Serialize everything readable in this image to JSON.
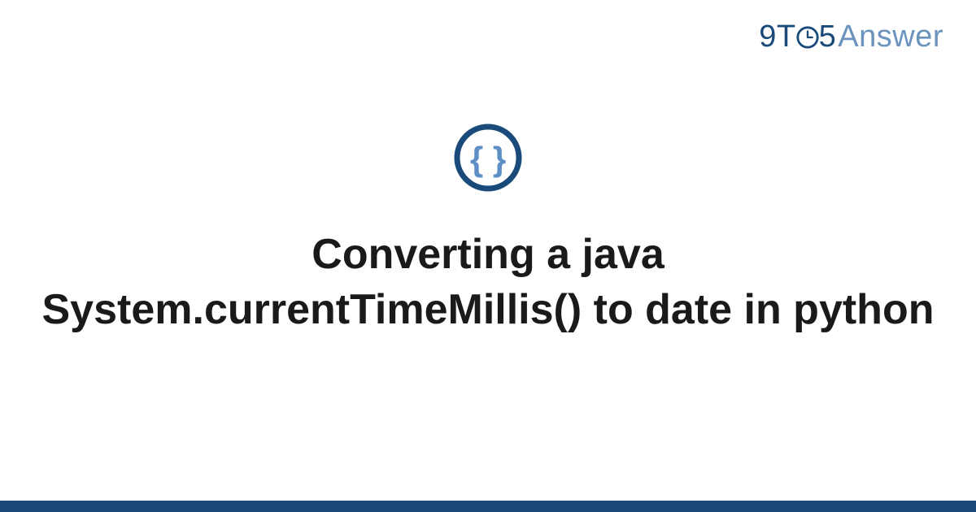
{
  "brand": {
    "nine": "9",
    "t": "T",
    "five": "5",
    "answer": "Answer"
  },
  "icon": {
    "name": "code-braces-icon"
  },
  "title": "Converting a java System.currentTimeMillis() to date in python",
  "colors": {
    "primary": "#1a4a7a",
    "accent": "#5d8fc6",
    "text": "#1a1a1a"
  }
}
